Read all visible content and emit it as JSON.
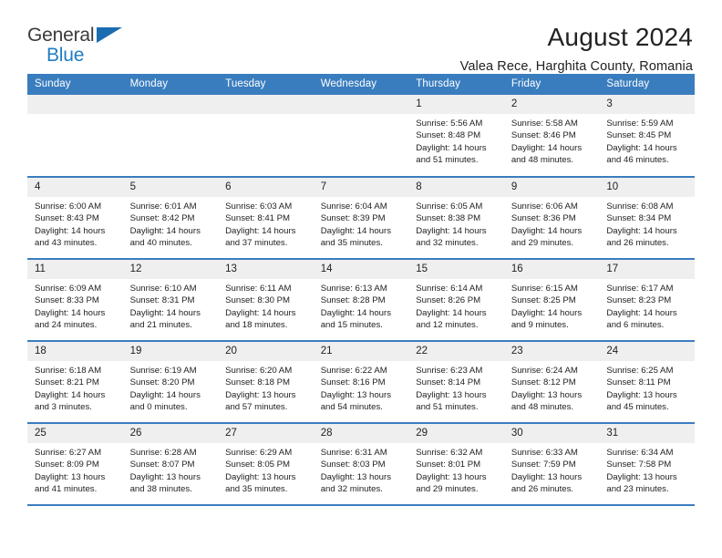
{
  "brand": {
    "name_top": "General",
    "name_bottom": "Blue"
  },
  "header": {
    "title": "August 2024",
    "subtitle": "Valea Rece, Harghita County, Romania"
  },
  "colors": {
    "header_blue": "#3a7dbf",
    "brand_blue": "#1f7dc2",
    "daynum_gray": "#efefef"
  },
  "weekdays": [
    "Sunday",
    "Monday",
    "Tuesday",
    "Wednesday",
    "Thursday",
    "Friday",
    "Saturday"
  ],
  "labels": {
    "sunrise_prefix": "Sunrise:",
    "sunset_prefix": "Sunset:",
    "daylight_prefix": "Daylight:"
  },
  "weeks": [
    [
      {
        "day": "",
        "blank": true,
        "sunrise": "",
        "sunset": "",
        "daylight_line1": "",
        "daylight_line2": ""
      },
      {
        "day": "",
        "blank": true,
        "sunrise": "",
        "sunset": "",
        "daylight_line1": "",
        "daylight_line2": ""
      },
      {
        "day": "",
        "blank": true,
        "sunrise": "",
        "sunset": "",
        "daylight_line1": "",
        "daylight_line2": ""
      },
      {
        "day": "",
        "blank": true,
        "sunrise": "",
        "sunset": "",
        "daylight_line1": "",
        "daylight_line2": ""
      },
      {
        "day": "1",
        "blank": false,
        "sunrise": "Sunrise: 5:56 AM",
        "sunset": "Sunset: 8:48 PM",
        "daylight_line1": "Daylight: 14 hours",
        "daylight_line2": "and 51 minutes."
      },
      {
        "day": "2",
        "blank": false,
        "sunrise": "Sunrise: 5:58 AM",
        "sunset": "Sunset: 8:46 PM",
        "daylight_line1": "Daylight: 14 hours",
        "daylight_line2": "and 48 minutes."
      },
      {
        "day": "3",
        "blank": false,
        "sunrise": "Sunrise: 5:59 AM",
        "sunset": "Sunset: 8:45 PM",
        "daylight_line1": "Daylight: 14 hours",
        "daylight_line2": "and 46 minutes."
      }
    ],
    [
      {
        "day": "4",
        "blank": false,
        "sunrise": "Sunrise: 6:00 AM",
        "sunset": "Sunset: 8:43 PM",
        "daylight_line1": "Daylight: 14 hours",
        "daylight_line2": "and 43 minutes."
      },
      {
        "day": "5",
        "blank": false,
        "sunrise": "Sunrise: 6:01 AM",
        "sunset": "Sunset: 8:42 PM",
        "daylight_line1": "Daylight: 14 hours",
        "daylight_line2": "and 40 minutes."
      },
      {
        "day": "6",
        "blank": false,
        "sunrise": "Sunrise: 6:03 AM",
        "sunset": "Sunset: 8:41 PM",
        "daylight_line1": "Daylight: 14 hours",
        "daylight_line2": "and 37 minutes."
      },
      {
        "day": "7",
        "blank": false,
        "sunrise": "Sunrise: 6:04 AM",
        "sunset": "Sunset: 8:39 PM",
        "daylight_line1": "Daylight: 14 hours",
        "daylight_line2": "and 35 minutes."
      },
      {
        "day": "8",
        "blank": false,
        "sunrise": "Sunrise: 6:05 AM",
        "sunset": "Sunset: 8:38 PM",
        "daylight_line1": "Daylight: 14 hours",
        "daylight_line2": "and 32 minutes."
      },
      {
        "day": "9",
        "blank": false,
        "sunrise": "Sunrise: 6:06 AM",
        "sunset": "Sunset: 8:36 PM",
        "daylight_line1": "Daylight: 14 hours",
        "daylight_line2": "and 29 minutes."
      },
      {
        "day": "10",
        "blank": false,
        "sunrise": "Sunrise: 6:08 AM",
        "sunset": "Sunset: 8:34 PM",
        "daylight_line1": "Daylight: 14 hours",
        "daylight_line2": "and 26 minutes."
      }
    ],
    [
      {
        "day": "11",
        "blank": false,
        "sunrise": "Sunrise: 6:09 AM",
        "sunset": "Sunset: 8:33 PM",
        "daylight_line1": "Daylight: 14 hours",
        "daylight_line2": "and 24 minutes."
      },
      {
        "day": "12",
        "blank": false,
        "sunrise": "Sunrise: 6:10 AM",
        "sunset": "Sunset: 8:31 PM",
        "daylight_line1": "Daylight: 14 hours",
        "daylight_line2": "and 21 minutes."
      },
      {
        "day": "13",
        "blank": false,
        "sunrise": "Sunrise: 6:11 AM",
        "sunset": "Sunset: 8:30 PM",
        "daylight_line1": "Daylight: 14 hours",
        "daylight_line2": "and 18 minutes."
      },
      {
        "day": "14",
        "blank": false,
        "sunrise": "Sunrise: 6:13 AM",
        "sunset": "Sunset: 8:28 PM",
        "daylight_line1": "Daylight: 14 hours",
        "daylight_line2": "and 15 minutes."
      },
      {
        "day": "15",
        "blank": false,
        "sunrise": "Sunrise: 6:14 AM",
        "sunset": "Sunset: 8:26 PM",
        "daylight_line1": "Daylight: 14 hours",
        "daylight_line2": "and 12 minutes."
      },
      {
        "day": "16",
        "blank": false,
        "sunrise": "Sunrise: 6:15 AM",
        "sunset": "Sunset: 8:25 PM",
        "daylight_line1": "Daylight: 14 hours",
        "daylight_line2": "and 9 minutes."
      },
      {
        "day": "17",
        "blank": false,
        "sunrise": "Sunrise: 6:17 AM",
        "sunset": "Sunset: 8:23 PM",
        "daylight_line1": "Daylight: 14 hours",
        "daylight_line2": "and 6 minutes."
      }
    ],
    [
      {
        "day": "18",
        "blank": false,
        "sunrise": "Sunrise: 6:18 AM",
        "sunset": "Sunset: 8:21 PM",
        "daylight_line1": "Daylight: 14 hours",
        "daylight_line2": "and 3 minutes."
      },
      {
        "day": "19",
        "blank": false,
        "sunrise": "Sunrise: 6:19 AM",
        "sunset": "Sunset: 8:20 PM",
        "daylight_line1": "Daylight: 14 hours",
        "daylight_line2": "and 0 minutes."
      },
      {
        "day": "20",
        "blank": false,
        "sunrise": "Sunrise: 6:20 AM",
        "sunset": "Sunset: 8:18 PM",
        "daylight_line1": "Daylight: 13 hours",
        "daylight_line2": "and 57 minutes."
      },
      {
        "day": "21",
        "blank": false,
        "sunrise": "Sunrise: 6:22 AM",
        "sunset": "Sunset: 8:16 PM",
        "daylight_line1": "Daylight: 13 hours",
        "daylight_line2": "and 54 minutes."
      },
      {
        "day": "22",
        "blank": false,
        "sunrise": "Sunrise: 6:23 AM",
        "sunset": "Sunset: 8:14 PM",
        "daylight_line1": "Daylight: 13 hours",
        "daylight_line2": "and 51 minutes."
      },
      {
        "day": "23",
        "blank": false,
        "sunrise": "Sunrise: 6:24 AM",
        "sunset": "Sunset: 8:12 PM",
        "daylight_line1": "Daylight: 13 hours",
        "daylight_line2": "and 48 minutes."
      },
      {
        "day": "24",
        "blank": false,
        "sunrise": "Sunrise: 6:25 AM",
        "sunset": "Sunset: 8:11 PM",
        "daylight_line1": "Daylight: 13 hours",
        "daylight_line2": "and 45 minutes."
      }
    ],
    [
      {
        "day": "25",
        "blank": false,
        "sunrise": "Sunrise: 6:27 AM",
        "sunset": "Sunset: 8:09 PM",
        "daylight_line1": "Daylight: 13 hours",
        "daylight_line2": "and 41 minutes."
      },
      {
        "day": "26",
        "blank": false,
        "sunrise": "Sunrise: 6:28 AM",
        "sunset": "Sunset: 8:07 PM",
        "daylight_line1": "Daylight: 13 hours",
        "daylight_line2": "and 38 minutes."
      },
      {
        "day": "27",
        "blank": false,
        "sunrise": "Sunrise: 6:29 AM",
        "sunset": "Sunset: 8:05 PM",
        "daylight_line1": "Daylight: 13 hours",
        "daylight_line2": "and 35 minutes."
      },
      {
        "day": "28",
        "blank": false,
        "sunrise": "Sunrise: 6:31 AM",
        "sunset": "Sunset: 8:03 PM",
        "daylight_line1": "Daylight: 13 hours",
        "daylight_line2": "and 32 minutes."
      },
      {
        "day": "29",
        "blank": false,
        "sunrise": "Sunrise: 6:32 AM",
        "sunset": "Sunset: 8:01 PM",
        "daylight_line1": "Daylight: 13 hours",
        "daylight_line2": "and 29 minutes."
      },
      {
        "day": "30",
        "blank": false,
        "sunrise": "Sunrise: 6:33 AM",
        "sunset": "Sunset: 7:59 PM",
        "daylight_line1": "Daylight: 13 hours",
        "daylight_line2": "and 26 minutes."
      },
      {
        "day": "31",
        "blank": false,
        "sunrise": "Sunrise: 6:34 AM",
        "sunset": "Sunset: 7:58 PM",
        "daylight_line1": "Daylight: 13 hours",
        "daylight_line2": "and 23 minutes."
      }
    ]
  ]
}
